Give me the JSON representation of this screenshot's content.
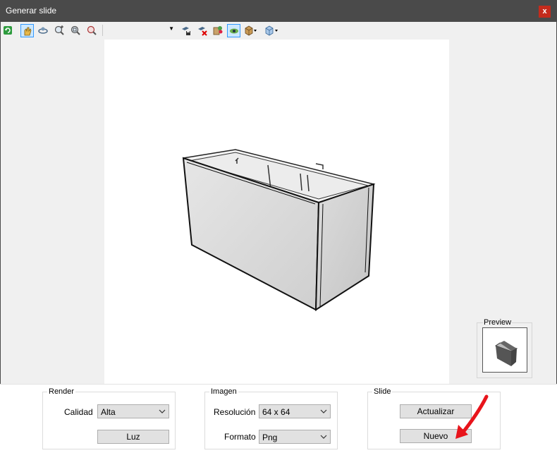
{
  "window": {
    "title": "Generar slide",
    "close_label": "x"
  },
  "toolbar": {
    "icons": [
      "refresh-icon",
      "pan-hand-icon",
      "orbit-icon",
      "zoom-in-icon",
      "zoom-window-icon",
      "zoom-extents-icon",
      "camera-save-icon",
      "camera-delete-icon",
      "materials-icon",
      "visibility-icon",
      "box-view-icon",
      "view-cube-icon"
    ],
    "view_select_value": ""
  },
  "preview": {
    "legend": "Preview"
  },
  "render_group": {
    "legend": "Render",
    "calidad_label": "Calidad",
    "calidad_value": "Alta",
    "luz_label": "Luz"
  },
  "imagen_group": {
    "legend": "Imagen",
    "resolucion_label": "Resolución",
    "resolucion_value": "64 x 64",
    "formato_label": "Formato",
    "formato_value": "Png"
  },
  "slide_group": {
    "legend": "Slide",
    "actualizar_label": "Actualizar",
    "nuevo_label": "Nuevo"
  },
  "colors": {
    "titlebar": "#4a4a4a",
    "close": "#c42b1c",
    "annotation_arrow": "#e8141b",
    "pressed": "#cce8ff"
  }
}
